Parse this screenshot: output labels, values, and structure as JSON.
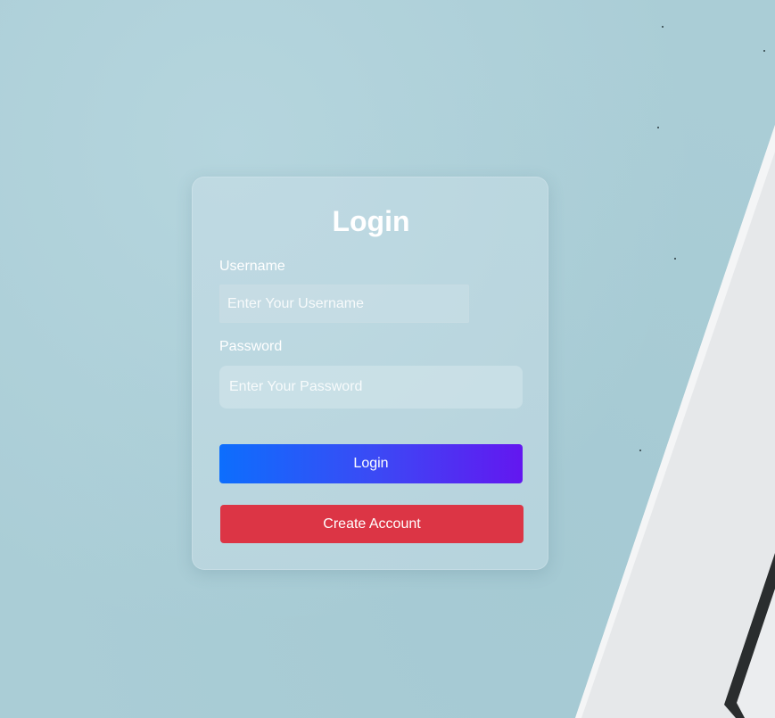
{
  "login_form": {
    "title": "Login",
    "username_label": "Username",
    "username_placeholder": "Enter Your Username",
    "username_value": "",
    "password_label": "Password",
    "password_placeholder": "Enter Your Password",
    "password_value": "",
    "login_button": "Login",
    "create_account_button": "Create Account"
  },
  "colors": {
    "background": "#aacdd6",
    "login_gradient_start": "#0d6efd",
    "login_gradient_end": "#6317f0",
    "create_account": "#dc3545",
    "text": "#ffffff"
  }
}
